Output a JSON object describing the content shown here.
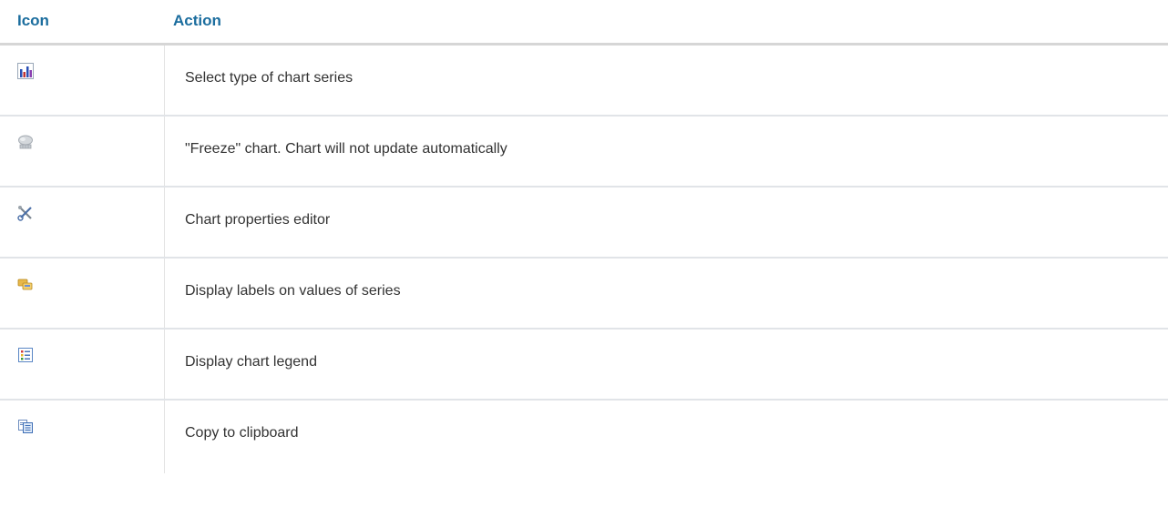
{
  "table": {
    "headers": {
      "icon": "Icon",
      "action": "Action"
    },
    "rows": [
      {
        "icon": "chart-series-type-icon",
        "action": "Select type of chart series"
      },
      {
        "icon": "freeze-chart-icon",
        "action": "\"Freeze\" chart. Chart will not update automatically"
      },
      {
        "icon": "properties-editor-icon",
        "action": "Chart properties editor"
      },
      {
        "icon": "series-labels-icon",
        "action": "Display labels on values of series"
      },
      {
        "icon": "chart-legend-icon",
        "action": "Display chart legend"
      },
      {
        "icon": "copy-clipboard-icon",
        "action": "Copy to clipboard"
      }
    ]
  },
  "colors": {
    "header_text": "#1b6d9e",
    "body_text": "#333333",
    "row_border": "#e1e4e8"
  }
}
